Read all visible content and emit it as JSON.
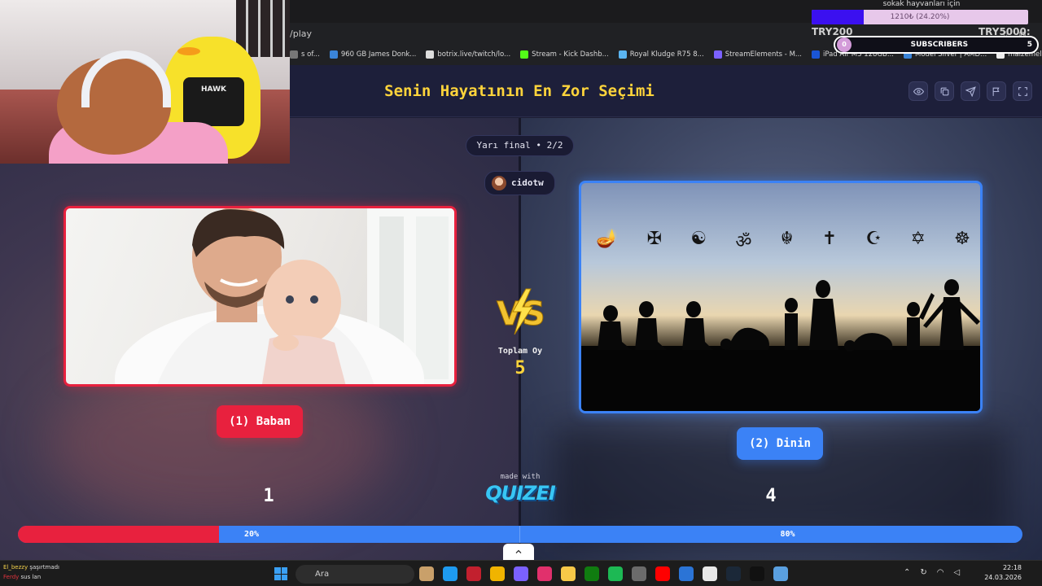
{
  "browser": {
    "address": "/play",
    "bookmarks": [
      {
        "label": "s of...",
        "color": "#777777"
      },
      {
        "label": "960 GB James Donk...",
        "color": "#3a84d8"
      },
      {
        "label": "botrix.live/twitch/lo...",
        "color": "#dddddd"
      },
      {
        "label": "Stream - Kick Dashb...",
        "color": "#53fc18"
      },
      {
        "label": "Royal Kludge R75 8...",
        "color": "#5ab4f0"
      },
      {
        "label": "StreamElements - M...",
        "color": "#7b61ff"
      },
      {
        "label": "iPad Air M3 128GB...",
        "color": "#1a55d6"
      },
      {
        "label": "Model Silver | AMD...",
        "color": "#3a84d8"
      },
      {
        "label": "malzemelik_5_2.pdf",
        "color": "#eeeeee"
      }
    ]
  },
  "overlay": {
    "donation_title": "sokak hayvanları için",
    "donation_text": "1210₺ (24.20%)",
    "donation_progress": 0.242,
    "left_tag": "TRY200",
    "right_tag": "TRY5000:",
    "subscribers_label": "SUBSCRIBERS",
    "subscribers_current": "0",
    "subscribers_goal": "5"
  },
  "webcam": {
    "shirt_text": "HAWK"
  },
  "app": {
    "title": "Senin Hayatının En Zor Seçimi",
    "header_buttons": [
      "eye-icon",
      "share-icon",
      "send-icon",
      "flag-icon",
      "fullscreen-icon"
    ],
    "round_label": "Yarı final • 2/2",
    "username": "cidotw",
    "vs_label": "VS",
    "total_votes_label": "Toplam Oy",
    "total_votes": "5",
    "options": [
      {
        "label": "(1) Baban",
        "votes": "1",
        "percent_label": "20%",
        "color": "#e8213e"
      },
      {
        "label": "(2) Dinin",
        "votes": "4",
        "percent_label": "80%",
        "color": "#3b82f6"
      }
    ],
    "left_share": 0.2,
    "made_with": "made with",
    "brand": "QUIZEI",
    "religious_symbols": [
      "🪔",
      "✠",
      "☯",
      "ॐ",
      "☬",
      "✝",
      "☪",
      "✡",
      "☸"
    ]
  },
  "taskbar": {
    "chat": [
      {
        "user": "El_bezzy",
        "message": "şaşırtmadı"
      },
      {
        "user": "Ferdy",
        "message": "sus lan"
      }
    ],
    "search_placeholder": "Ara",
    "time": "22:18",
    "date": "24.03.2026"
  }
}
